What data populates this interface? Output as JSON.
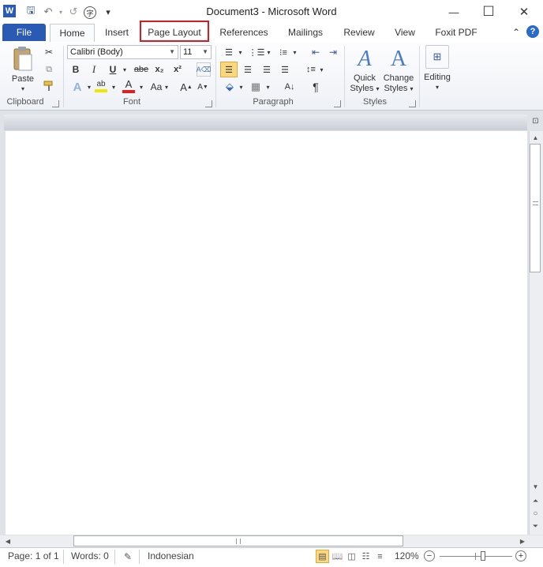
{
  "window": {
    "title": "Document3 - Microsoft Word",
    "minimize_glyph": "—",
    "maximize_glyph": "☐",
    "close_glyph": "✕"
  },
  "qat": {
    "word_icon": "W",
    "save_icon": "🖫",
    "undo_icon": "↶",
    "redo_icon": "↺",
    "customize_icon": "▾"
  },
  "tabs": [
    {
      "label": "File"
    },
    {
      "label": "Home"
    },
    {
      "label": "Insert"
    },
    {
      "label": "Page Layout"
    },
    {
      "label": "References"
    },
    {
      "label": "Mailings"
    },
    {
      "label": "Review"
    },
    {
      "label": "View"
    },
    {
      "label": "Foxit PDF"
    }
  ],
  "ribbon_right": {
    "collapse_icon": "⌃",
    "help_icon": "?"
  },
  "clipboard": {
    "paste_label": "Paste",
    "group_label": "Clipboard"
  },
  "font": {
    "font_name": "Calibri (Body)",
    "font_size": "11",
    "bold": "B",
    "italic": "I",
    "underline": "U",
    "strikethrough": "abe",
    "subscript": "x₂",
    "superscript": "x²",
    "grow": "A",
    "shrink": "A",
    "change_case": "Aa",
    "group_label": "Font"
  },
  "paragraph": {
    "pilcrow": "¶",
    "group_label": "Paragraph"
  },
  "styles": {
    "quick_styles_line1": "Quick",
    "quick_styles_line2": "Styles",
    "change_styles_line1": "Change",
    "change_styles_line2": "Styles",
    "group_label": "Styles"
  },
  "editing": {
    "label": "Editing"
  },
  "status": {
    "page": "Page: 1 of 1",
    "words": "Words: 0",
    "language": "Indonesian",
    "zoom": "120%",
    "zoom_level": 0.6
  },
  "colors": {
    "file_tab": "#2a5ab3",
    "highlight_box": "#d81b22",
    "font_color_bar": "#e02020",
    "highlighter_bar": "#f2e600"
  }
}
